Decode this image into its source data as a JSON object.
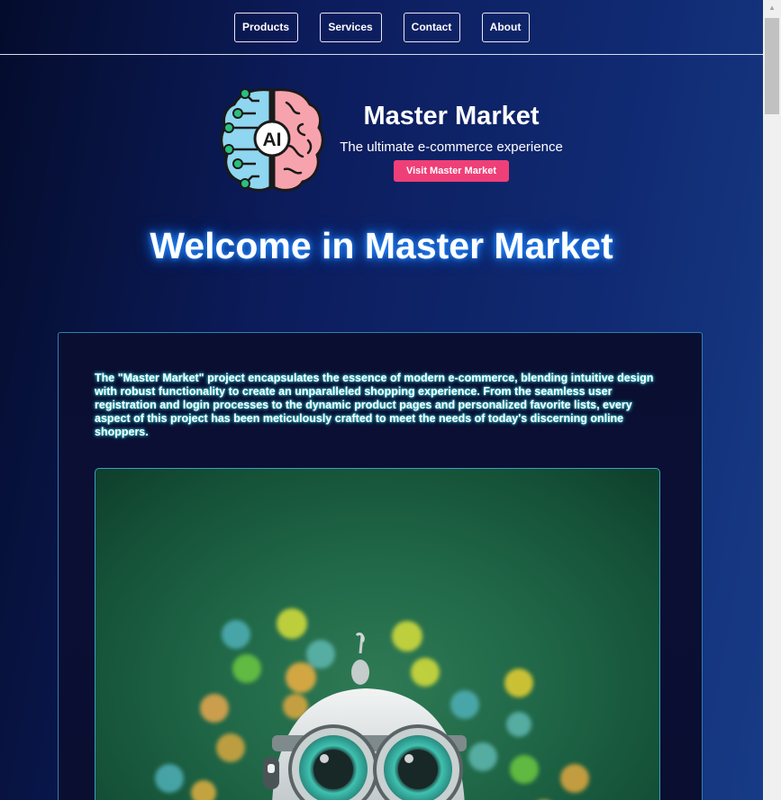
{
  "nav": {
    "items": [
      {
        "label": "Products"
      },
      {
        "label": "Services"
      },
      {
        "label": "Contact"
      },
      {
        "label": "About"
      }
    ]
  },
  "hero": {
    "logo_icon": "ai-brain-icon",
    "logo_text": "AI",
    "title": "Master Market",
    "tagline": "The ultimate e-commerce experience",
    "cta_label": "Visit Master Market"
  },
  "welcome": {
    "heading": "Welcome in Master Market"
  },
  "content": {
    "description": "The \"Master Market\" project encapsulates the essence of modern e-commerce, blending intuitive design with robust functionality to create an unparalleled shopping experience. From the seamless user registration and login processes to the dynamic product pages and personalized favorite lists, every aspect of this project has been meticulously crafted to meet the needs of today's discerning online shoppers.",
    "image_icon": "robot-illustration"
  },
  "colors": {
    "accent": "#ef3f78",
    "background_dark": "#040c2c",
    "background_light": "#183c88",
    "card_border": "#2f7fb0",
    "glow": "#2a8cff"
  }
}
